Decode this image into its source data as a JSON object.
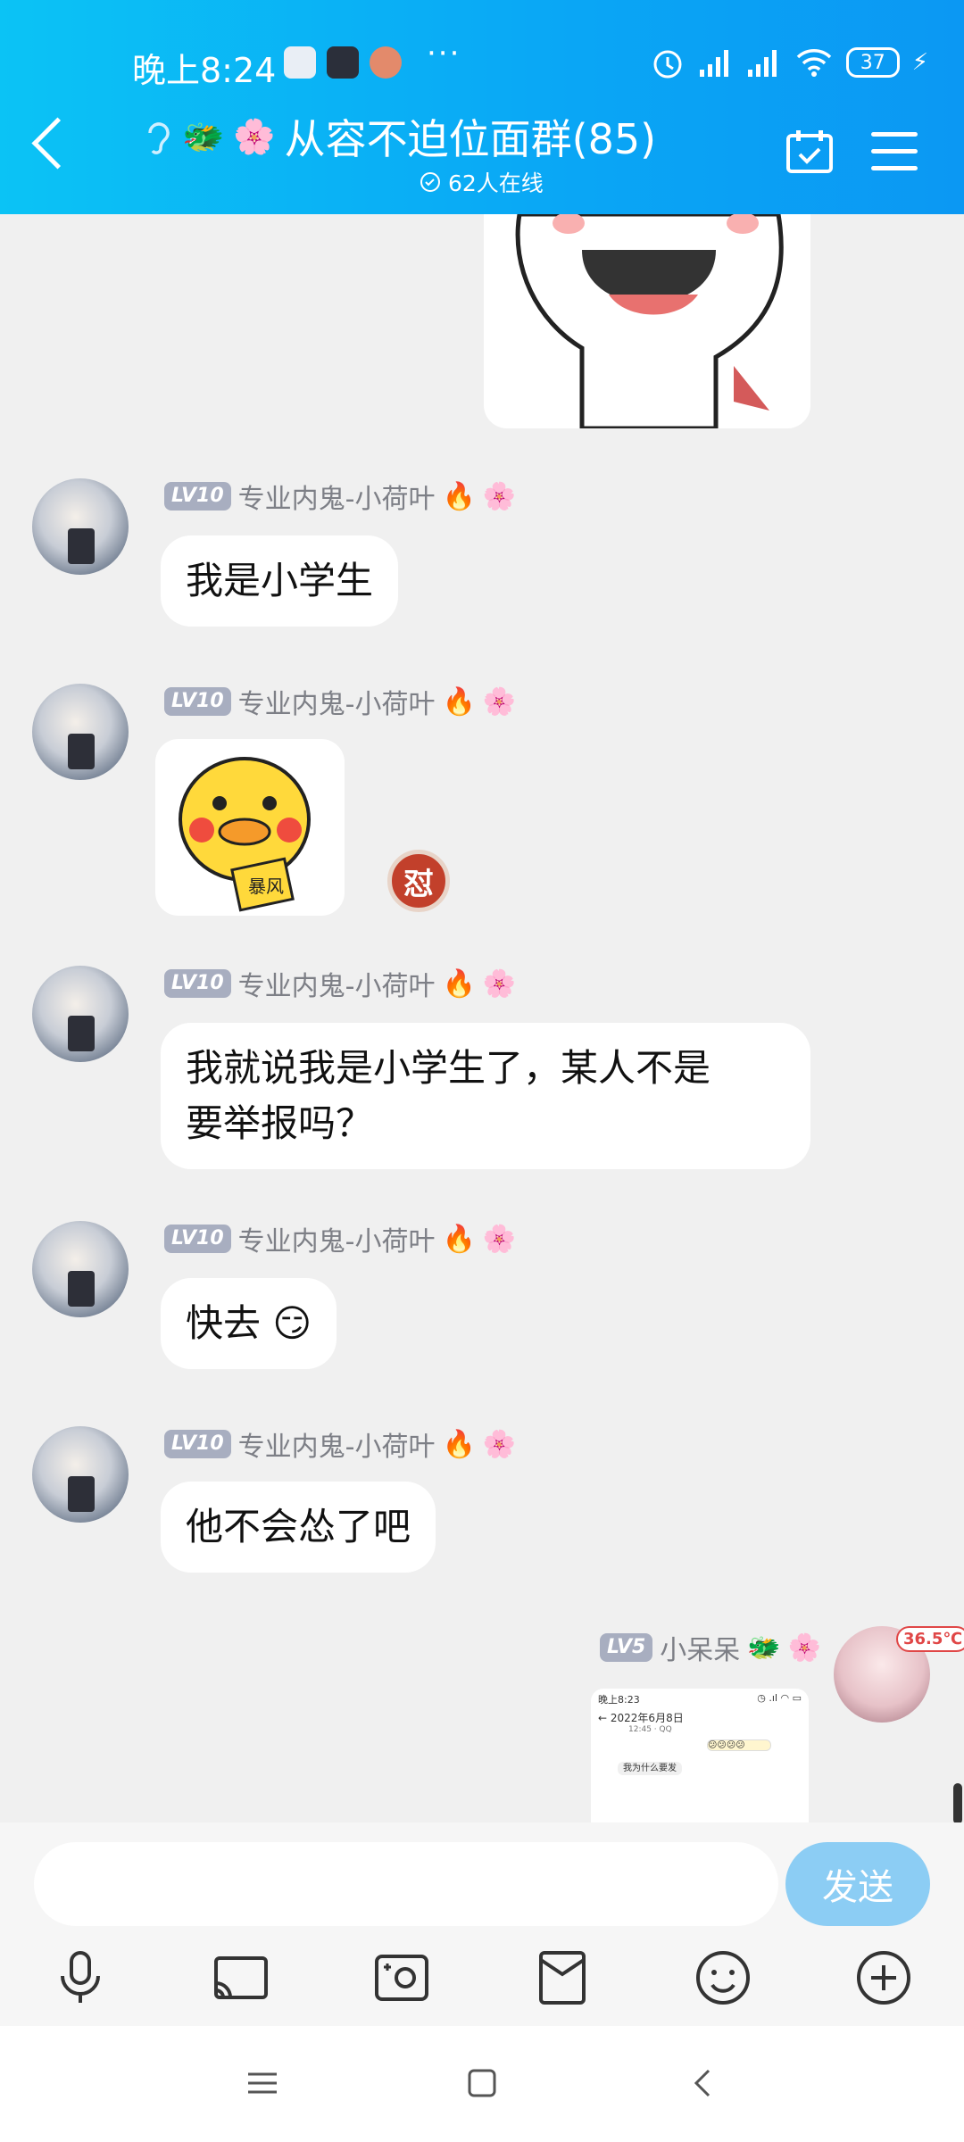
{
  "status_bar": {
    "time": "晚上8:24",
    "more": "···",
    "battery": "37"
  },
  "header": {
    "title": "从容不迫位面群(85)",
    "online": "62人在线"
  },
  "messages": [
    {
      "level": "LV10",
      "nickname": "专业内鬼-小荷叶",
      "text": "我是小学生"
    },
    {
      "level": "LV10",
      "nickname": "专业内鬼-小荷叶",
      "sticker_text": "暴风",
      "reaction": "怼"
    },
    {
      "level": "LV10",
      "nickname": "专业内鬼-小荷叶",
      "line1": "我就说我是小学生了，某人不是",
      "line2": "要举报吗？"
    },
    {
      "level": "LV10",
      "nickname": "专业内鬼-小荷叶",
      "text": "快去"
    },
    {
      "level": "LV10",
      "nickname": "专业内鬼-小荷叶",
      "text": "他不会怂了吧"
    }
  ],
  "self_message": {
    "level": "LV5",
    "nickname": "小呆呆",
    "temperature": "36.5℃",
    "screenshot": {
      "time": "晚上8:23",
      "date": "2022年6月8日",
      "sub": "12:45 · QQ",
      "msg": "我为什么要发"
    }
  },
  "input": {
    "placeholder": "",
    "send_label": "发送"
  },
  "colors": {
    "header": "#0aa6f5",
    "send_button": "#8ccdf4",
    "background": "#f0f0f0"
  }
}
